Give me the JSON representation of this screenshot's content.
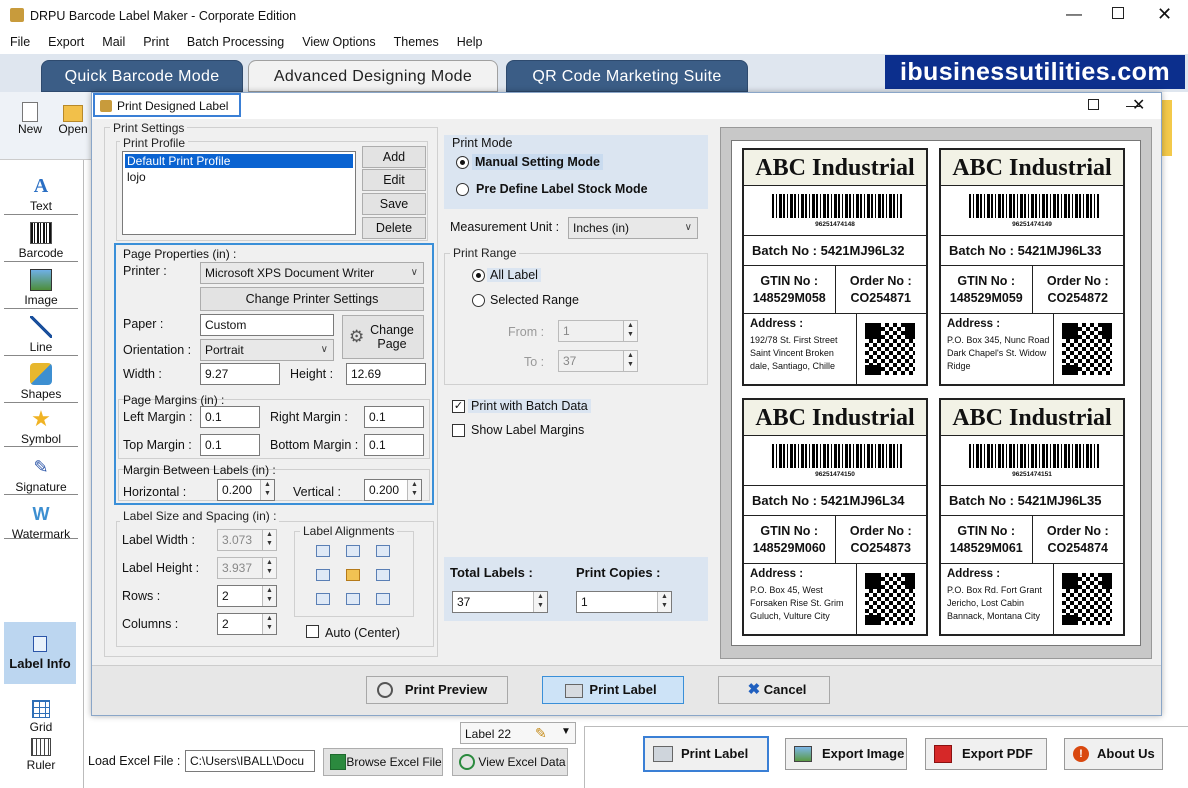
{
  "app": {
    "title": "DRPU Barcode Label Maker - Corporate Edition"
  },
  "menu": [
    "File",
    "Export",
    "Mail",
    "Print",
    "Batch Processing",
    "View Options",
    "Themes",
    "Help"
  ],
  "modes": {
    "quick": "Quick Barcode Mode",
    "advanced": "Advanced Designing Mode",
    "qr": "QR Code Marketing Suite"
  },
  "brand": "ibusinessutilities.com",
  "toolbar": {
    "new": "New",
    "open": "Open"
  },
  "tools": [
    "Text",
    "Barcode",
    "Image",
    "Line",
    "Shapes",
    "Symbol",
    "Signature",
    "Watermark"
  ],
  "left_bottom": {
    "label_info": "Label Info",
    "grid": "Grid",
    "ruler": "Ruler"
  },
  "dialog": {
    "title": "Print Designed Label",
    "print_settings": "Print Settings",
    "print_profile": "Print Profile",
    "profiles": [
      "Default Print Profile",
      "lojo"
    ],
    "profile_buttons": {
      "add": "Add",
      "edit": "Edit",
      "save": "Save",
      "delete": "Delete"
    },
    "page_properties": "Page Properties (in) :",
    "printer_label": "Printer :",
    "printer_value": "Microsoft XPS Document Writer",
    "change_printer": "Change Printer Settings",
    "paper_label": "Paper :",
    "paper_value": "Custom",
    "change_page": "Change Page",
    "orientation_label": "Orientation :",
    "orientation_value": "Portrait",
    "width_label": "Width :",
    "width_value": "9.27",
    "height_label": "Height :",
    "height_value": "12.69",
    "page_margins": "Page Margins (in) :",
    "left_margin_label": "Left Margin :",
    "left_margin": "0.1",
    "right_margin_label": "Right Margin :",
    "right_margin": "0.1",
    "top_margin_label": "Top Margin :",
    "top_margin": "0.1",
    "bottom_margin_label": "Bottom Margin :",
    "bottom_margin": "0.1",
    "margin_between": "Margin Between Labels (in) :",
    "horizontal_label": "Horizontal :",
    "horizontal": "0.200",
    "vertical_label": "Vertical :",
    "vertical": "0.200",
    "label_size": "Label Size and Spacing (in) :",
    "label_width_label": "Label Width :",
    "label_width": "3.073",
    "label_height_label": "Label Height :",
    "label_height": "3.937",
    "rows_label": "Rows :",
    "rows": "2",
    "columns_label": "Columns :",
    "columns": "2",
    "label_alignments": "Label Alignments",
    "auto_center": "Auto (Center)",
    "print_mode": "Print Mode",
    "manual_mode": "Manual Setting Mode",
    "predefine_mode": "Pre Define Label Stock Mode",
    "measurement_label": "Measurement Unit :",
    "measurement_value": "Inches (in)",
    "print_range": "Print Range",
    "all_label": "All Label",
    "selected_range": "Selected Range",
    "from_label": "From :",
    "from_value": "1",
    "to_label": "To :",
    "to_value": "37",
    "print_batch": "Print with Batch Data",
    "show_margins": "Show Label Margins",
    "total_labels_label": "Total Labels :",
    "total_labels": "37",
    "print_copies_label": "Print Copies :",
    "print_copies": "1",
    "print_preview": "Print Preview",
    "print_label": "Print Label",
    "cancel": "Cancel"
  },
  "labels": [
    {
      "title": "ABC Industrial",
      "barcode_num": "96251474148",
      "batch": "Batch No :  5421MJ96L32",
      "gtin_label": "GTIN No :",
      "gtin": "148529M058",
      "order_label": "Order No :",
      "order": "CO254871",
      "addr_label": "Address :",
      "addr": "192/78 St. First Street Saint Vincent Broken dale, Santiago, Chille"
    },
    {
      "title": "ABC Industrial",
      "barcode_num": "96251474149",
      "batch": "Batch No :  5421MJ96L33",
      "gtin_label": "GTIN No :",
      "gtin": "148529M059",
      "order_label": "Order No :",
      "order": "CO254872",
      "addr_label": "Address :",
      "addr": "P.O. Box 345, Nunc Road Dark Chapel's St. Widow Ridge"
    },
    {
      "title": "ABC Industrial",
      "barcode_num": "96251474150",
      "batch": "Batch No :  5421MJ96L34",
      "gtin_label": "GTIN No :",
      "gtin": "148529M060",
      "order_label": "Order No :",
      "order": "CO254873",
      "addr_label": "Address :",
      "addr": "P.O. Box 45, West Forsaken Rise St. Grim Guluch, Vulture City"
    },
    {
      "title": "ABC Industrial",
      "barcode_num": "96251474151",
      "batch": "Batch No :  5421MJ96L35",
      "gtin_label": "GTIN No :",
      "gtin": "148529M061",
      "order_label": "Order No :",
      "order": "CO254874",
      "addr_label": "Address :",
      "addr": "P.O. Box Rd. Fort Grant Jericho, Lost Cabin Bannack, Montana City"
    }
  ],
  "behind": {
    "label_row": "Label 22",
    "load_excel_label": "Load Excel File :",
    "excel_path": "C:\\Users\\IBALL\\Docu",
    "browse_excel": "Browse Excel File",
    "view_excel": "View Excel Data",
    "print_label": "Print Label",
    "export_image": "Export Image",
    "export_pdf": "Export PDF",
    "about_us": "About Us"
  }
}
